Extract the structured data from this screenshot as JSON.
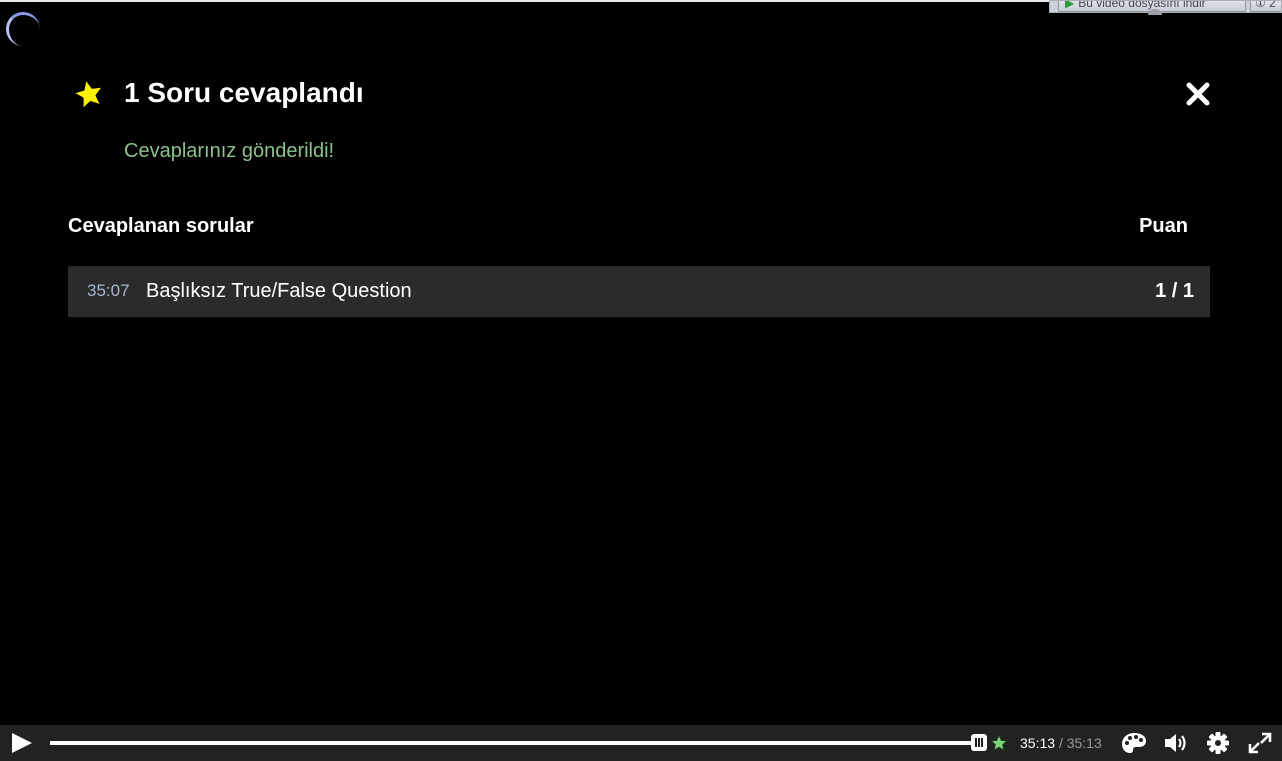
{
  "download_bar": {
    "label": "Bu video dosyasını indir",
    "extra": "① 2"
  },
  "summary": {
    "title": "1 Soru cevaplandı",
    "message": "Cevaplarınız gönderildi!",
    "close_icon": "close-x-icon",
    "star_icon": "star-icon",
    "star_color": "#fff200",
    "message_color": "#8cc08c"
  },
  "answered": {
    "header_left": "Cevaplanan sorular",
    "header_right": "Puan",
    "items": [
      {
        "time": "35:07",
        "title": "Başlıksız True/False Question",
        "score": "1 / 1"
      }
    ]
  },
  "controls": {
    "current_time": "35:13",
    "separator": "/",
    "total_time": "35:13",
    "progress_fraction": 1.0,
    "icons": [
      "play-icon",
      "palette-icon",
      "volume-icon",
      "settings-icon",
      "fullscreen-icon"
    ]
  }
}
